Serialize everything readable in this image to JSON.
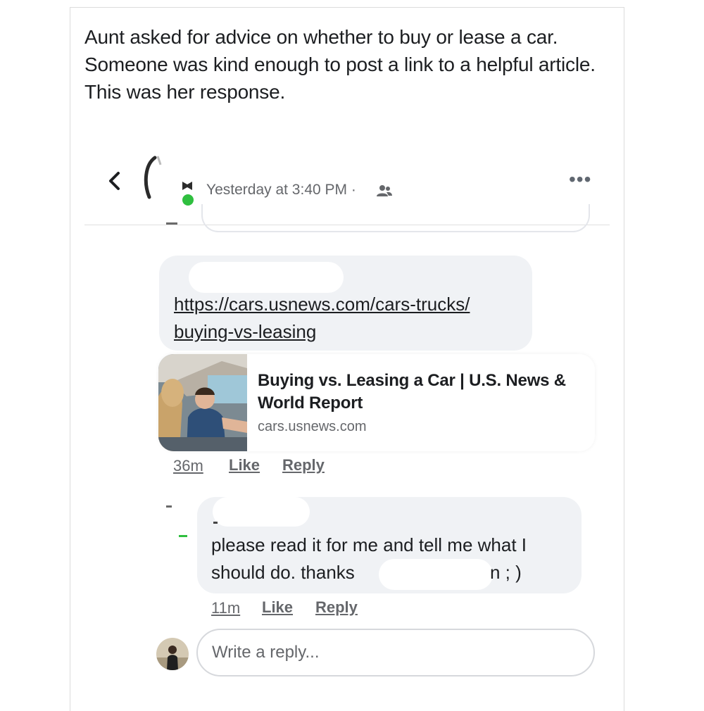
{
  "post": {
    "caption": "Aunt asked for advice on whether to buy or lease a car. Someone was kind enough to post a link to a helpful article. This was her response."
  },
  "thread_header": {
    "back_icon": "chevron-left-icon",
    "timestamp": "Yesterday at 3:40 PM ·",
    "audience_icon": "friends-icon",
    "more_icon": "more-options-icon",
    "more_label": "•••"
  },
  "comment1": {
    "link": "https://cars.usnews.com/cars-trucks/ buying-vs-leasing",
    "card": {
      "title": "Buying vs. Leasing a Car | U.S. News & World Report",
      "domain": "cars.usnews.com"
    },
    "time": "36m",
    "like": "Like",
    "reply": "Reply"
  },
  "comment2": {
    "text": "please read it for me and tell me what I should do. thanks",
    "tail": "n ; )",
    "time": "11m",
    "like": "Like",
    "reply": "Reply"
  },
  "composer": {
    "placeholder": "Write a reply..."
  },
  "colors": {
    "bubble": "#f0f2f5",
    "meta_text": "#65676b",
    "text": "#1c1e21",
    "online": "#2fbf3f"
  }
}
